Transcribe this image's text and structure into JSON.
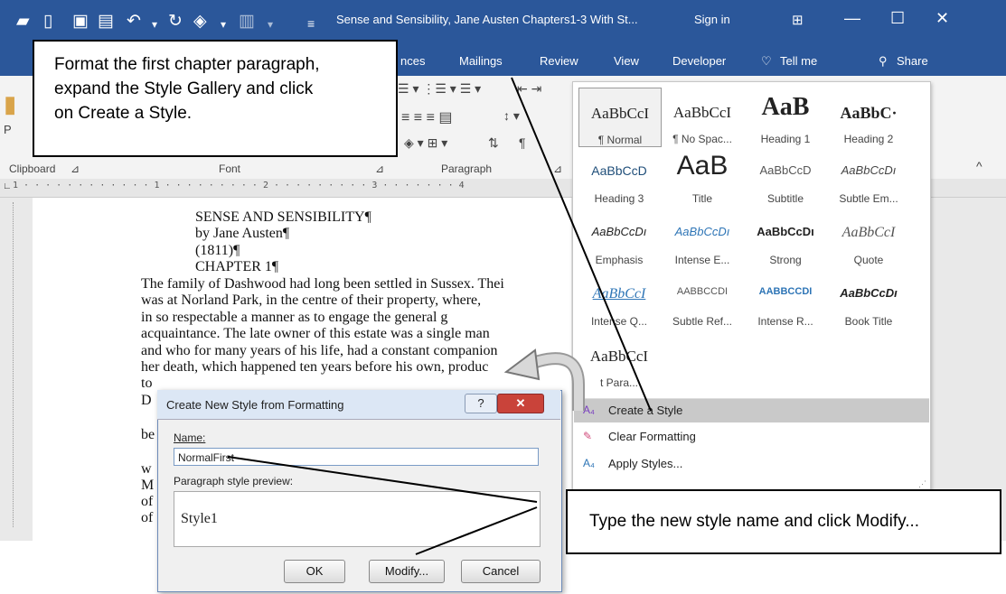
{
  "titlebar": {
    "doc_title": "Sense and Sensibility, Jane Austen Chapters1-3 With St...",
    "sign_in": "Sign in",
    "qa_icons": [
      "folder-icon",
      "new-doc-icon",
      "save-icon",
      "save-as-icon",
      "undo-icon",
      "redo-icon",
      "touch-mode-icon",
      "customize-icon"
    ],
    "window_controls": {
      "restore_ribbon": "⊞",
      "minimize": "—",
      "maximize": "☐",
      "close": "✕"
    }
  },
  "tabs": [
    {
      "label": "nces"
    },
    {
      "label": "Mailings"
    },
    {
      "label": "Review"
    },
    {
      "label": "View"
    },
    {
      "label": "Developer"
    },
    {
      "label": "Tell me"
    }
  ],
  "share_label": "Share",
  "ribbon": {
    "groups": {
      "clipboard": "Clipboard",
      "font": "Font",
      "paragraph": "Paragraph"
    },
    "paste_letter": "P"
  },
  "ruler_text": "1 · · · · · · · · · · · · 1 · · · · · · · · · 2 · · · · · · · · · 3 · · · · · · · 4",
  "document": {
    "heading_lines": [
      "SENSE AND SENSIBILITY¶",
      "by Jane Austen¶",
      "(1811)¶",
      "CHAPTER 1¶"
    ],
    "body_lines": [
      "The family of Dashwood had long been settled in Sussex. Thei",
      "was at Norland Park, in the centre of their property, where,",
      "in so respectable a manner as to engage the general g",
      "acquaintance. The late owner of this estate was a single man",
      "and who for many years of his life, had a constant companion",
      "her death, which happened ten years before his own, produc"
    ],
    "side_fragments": [
      "to",
      "D",
      "be",
      "w",
      "M",
      "of",
      "of"
    ]
  },
  "style_gallery": {
    "styles": [
      {
        "preview": "AaBbCcI",
        "name": "¶ Normal"
      },
      {
        "preview": "AaBbCcI",
        "name": "¶ No Spac..."
      },
      {
        "preview": "AaB",
        "name": "Heading 1"
      },
      {
        "preview": "AaBbC·",
        "name": "Heading 2"
      },
      {
        "preview": "AaBbCcD",
        "name": "Heading 3"
      },
      {
        "preview": "AaB",
        "name": "Title"
      },
      {
        "preview": "AaBbCcD",
        "name": "Subtitle"
      },
      {
        "preview": "AaBbCcDı",
        "name": "Subtle Em..."
      },
      {
        "preview": "AaBbCcDı",
        "name": "Emphasis"
      },
      {
        "preview": "AaBbCcDı",
        "name": "Intense E..."
      },
      {
        "preview": "AaBbCcDı",
        "name": "Strong"
      },
      {
        "preview": "AaBbCcI",
        "name": "Quote"
      },
      {
        "preview": "AaBbCcI",
        "name": "Intense Q..."
      },
      {
        "preview": "AABBCCDI",
        "name": "Subtle Ref..."
      },
      {
        "preview": "AABBCCDI",
        "name": "Intense R..."
      },
      {
        "preview": "AaBbCcDı",
        "name": "Book Title"
      },
      {
        "preview": "AaBbCcI",
        "name": "t Para..."
      }
    ],
    "menu": {
      "create_style": "Create a Style",
      "clear_formatting": "Clear Formatting",
      "apply_styles": "Apply Styles..."
    }
  },
  "dialog": {
    "title": "Create New Style from Formatting",
    "help_btn": "?",
    "close_btn": "✕",
    "name_label": "Name:",
    "name_value": "NormalFirst",
    "preview_label": "Paragraph style preview:",
    "preview_text": "Style1",
    "ok_label": "OK",
    "modify_label": "Modify...",
    "cancel_label": "Cancel"
  },
  "callouts": {
    "top": [
      "Format the first chapter paragraph,",
      "expand the Style Gallery and click",
      "on Create a Style."
    ],
    "bottom": "Type the new style name and click Modify..."
  },
  "colors": {
    "ribbon_blue": "#2b579a",
    "selected_menu": "#c9c9c9",
    "dialog_border": "#6c8bb8"
  }
}
